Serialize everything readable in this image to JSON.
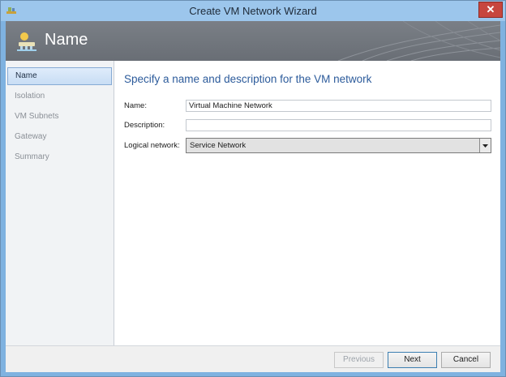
{
  "window": {
    "title": "Create VM Network Wizard",
    "close_glyph": "✕"
  },
  "banner": {
    "title": "Name",
    "icon": "network-wizard-icon"
  },
  "sidebar": {
    "items": [
      {
        "label": "Name",
        "active": true
      },
      {
        "label": "Isolation",
        "active": false
      },
      {
        "label": "VM Subnets",
        "active": false
      },
      {
        "label": "Gateway",
        "active": false
      },
      {
        "label": "Summary",
        "active": false
      }
    ]
  },
  "main": {
    "heading": "Specify a name and description for the VM network",
    "name_label": "Name:",
    "name_value": "Virtual Machine Network",
    "description_label": "Description:",
    "description_value": "",
    "logical_network_label": "Logical network:",
    "logical_network_value": "Service Network"
  },
  "footer": {
    "previous_label": "Previous",
    "next_label": "Next",
    "cancel_label": "Cancel"
  },
  "colors": {
    "heading": "#2c5b9b",
    "banner": "#6f747b",
    "close_button": "#c7463e",
    "window_frame": "#9cc6ec"
  }
}
